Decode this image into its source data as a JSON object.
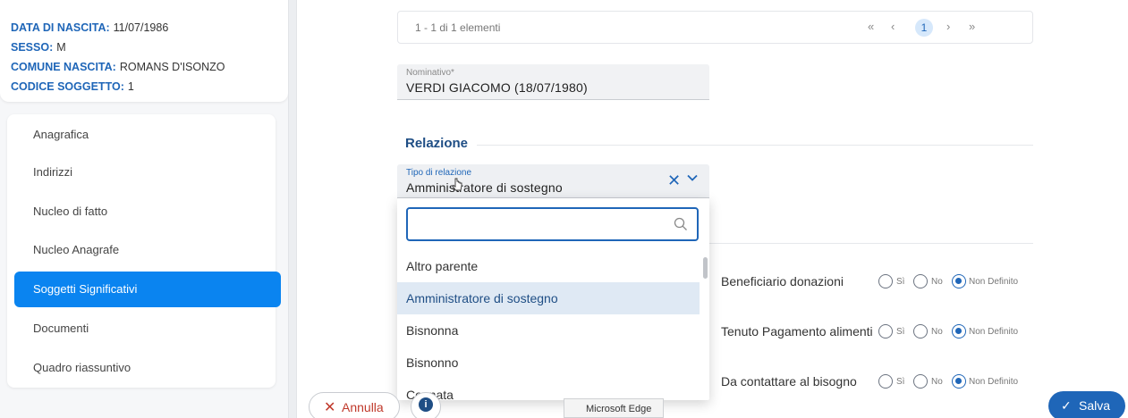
{
  "subject": {
    "birth_date_label": "DATA DI NASCITA:",
    "birth_date": "11/07/1986",
    "sex_label": "SESSO:",
    "sex": "M",
    "birth_place_label": "COMUNE NASCITA:",
    "birth_place": "ROMANS D'ISONZO",
    "code_label": "CODICE SOGGETTO:",
    "code": "1"
  },
  "menu": {
    "items": [
      {
        "label": "Anagrafica"
      },
      {
        "label": "Indirizzi"
      },
      {
        "label": "Nucleo di fatto"
      },
      {
        "label": "Nucleo Anagrafe"
      },
      {
        "label": "Soggetti Significativi"
      },
      {
        "label": "Documenti"
      },
      {
        "label": "Quadro riassuntivo"
      }
    ],
    "active_index": 4
  },
  "paginator": {
    "count_text": "1 - 1 di 1 elementi",
    "first": "«",
    "prev": "‹",
    "page": "1",
    "next": "›",
    "last": "»"
  },
  "nominativo": {
    "label": "Nominativo*",
    "value": "VERDI GIACOMO (18/07/1980)"
  },
  "relazione": {
    "section_title": "Relazione",
    "tipo_label": "Tipo di relazione",
    "tipo_value": "Amministratore di sostegno",
    "clear_glyph": "✕"
  },
  "dropdown": {
    "search_value": "",
    "options": [
      {
        "label": "Altro parente"
      },
      {
        "label": "Amministratore di sostegno"
      },
      {
        "label": "Bisnonna"
      },
      {
        "label": "Bisnonno"
      },
      {
        "label": "Cognata"
      }
    ],
    "selected_index": 1
  },
  "radio_rows": [
    {
      "label": "Beneficiario donazioni",
      "options": [
        "Sì",
        "No",
        "Non Definito"
      ],
      "selected": "Non Definito"
    },
    {
      "label": "Tenuto Pagamento alimenti",
      "options": [
        "Sì",
        "No",
        "Non Definito"
      ],
      "selected": "Non Definito"
    },
    {
      "label": "Da contattare al bisogno",
      "options": [
        "Sì",
        "No",
        "Non Definito"
      ],
      "selected": "Non Definito"
    }
  ],
  "actions": {
    "cancel_label": "Annulla",
    "cancel_glyph": "✕",
    "info_glyph": "i",
    "save_label": "Salva",
    "save_glyph": "✓"
  },
  "tooltip": {
    "text": "Microsoft Edge"
  },
  "colors": {
    "primary": "#1f66b8",
    "menu_active": "#0a84f0",
    "danger": "#c0392b"
  }
}
